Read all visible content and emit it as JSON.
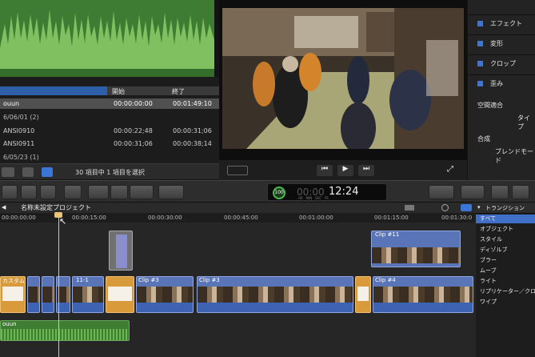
{
  "browser": {
    "col_start": "開始",
    "col_end": "終了",
    "rows": [
      {
        "name": "ouun",
        "start": "00:00:00:00",
        "end": "00:01:49:10",
        "selected": true,
        "group": false
      },
      {
        "name": "6/06/01 (2)",
        "start": "",
        "end": "",
        "selected": false,
        "group": true
      },
      {
        "name": "ANSI0910",
        "start": "00:00:22;48",
        "end": "00:00:31;06",
        "selected": false,
        "group": false
      },
      {
        "name": "ANSI0911",
        "start": "00:00:31;06",
        "end": "00:00:38;14",
        "selected": false,
        "group": false
      },
      {
        "name": "6/05/23 (1)",
        "start": "",
        "end": "",
        "selected": false,
        "group": true
      }
    ],
    "footer_text": "30 項目中 1 項目を選択"
  },
  "inspector": {
    "items": [
      "エフェクト",
      "変形",
      "クロップ",
      "歪み"
    ],
    "composite_header": "空間適合",
    "composite_value": "タイプ",
    "blend_header": "合成",
    "blend_value": "ブレンドモード"
  },
  "toolbar": {
    "percent": "100",
    "timecode": "12:24",
    "timecode_dim": "00:00",
    "tc_labels": "HR   MIN   SEC   FR"
  },
  "timeline": {
    "project_name": "名称未設定プロジェクト",
    "ruler": [
      "00:00:00:00",
      "00:00:15:00",
      "00:00:30:00",
      "00:00:45:00",
      "00:01:00:00",
      "00:01:15:00",
      "00:01:30:0"
    ],
    "clips": {
      "c11": "Clip #11",
      "c3a": "Clip #3",
      "c3b": "Clip #3",
      "c4": "Clip #4",
      "custom": "カスタム",
      "c111": "11-1",
      "bottom_audio": "ouun"
    }
  },
  "transitions": {
    "title": "トランジション",
    "items": [
      "すべて",
      "オブジェクト",
      "スタイル",
      "ディゾルブ",
      "ブラー",
      "ムーブ",
      "ライト",
      "リプリケーター／クロ",
      "ワイプ"
    ]
  },
  "colors": {
    "accent": "#3b76d6",
    "clip_blue": "#5a74b8",
    "clip_orange": "#d89a3a",
    "audio_green": "#3f7d33"
  }
}
